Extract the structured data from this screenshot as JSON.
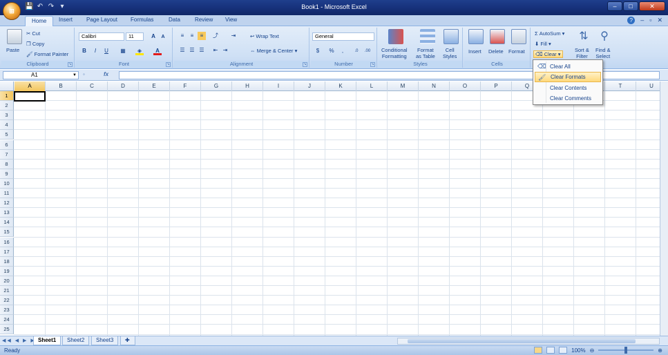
{
  "window": {
    "title": "Book1 - Microsoft Excel",
    "office_button_label": "⊞",
    "controls": [
      "–",
      "□",
      "✕"
    ]
  },
  "quick_access": [
    "💾",
    "↶",
    "↷",
    "▾"
  ],
  "tabs": [
    {
      "label": "Home",
      "active": true
    },
    {
      "label": "Insert"
    },
    {
      "label": "Page Layout"
    },
    {
      "label": "Formulas"
    },
    {
      "label": "Data"
    },
    {
      "label": "Review"
    },
    {
      "label": "View"
    }
  ],
  "ribbon_right": {
    "help": "?",
    "minimize": "–",
    "restore": "▫",
    "close": "✕"
  },
  "groups": {
    "clipboard": {
      "label": "Clipboard",
      "paste": "Paste",
      "cut": "Cut",
      "copy": "Copy",
      "format_painter": "Format Painter"
    },
    "font": {
      "label": "Font",
      "font_name": "Calibri",
      "font_size": "11",
      "grow": "A",
      "shrink": "A",
      "bold": "B",
      "italic": "I",
      "underline": "U"
    },
    "alignment": {
      "label": "Alignment",
      "wrap_text": "Wrap Text",
      "merge_center": "Merge & Center"
    },
    "number": {
      "label": "Number",
      "format": "General",
      "currency": "$",
      "percent": "%",
      "comma": ",",
      "inc_decimal": ".0",
      "dec_decimal": ".00"
    },
    "styles": {
      "label": "Styles",
      "conditional": "Conditional",
      "conditional2": "Formatting",
      "format_table": "Format",
      "format_table2": "as Table",
      "cell_styles": "Cell",
      "cell_styles2": "Styles"
    },
    "cells": {
      "label": "Cells",
      "insert": "Insert",
      "delete": "Delete",
      "format": "Format"
    },
    "editing": {
      "autosum": "AutoSum",
      "fill": "Fill",
      "clear": "Clear",
      "sort_filter": "Sort &",
      "sort_filter2": "Filter",
      "find_select": "Find &",
      "find_select2": "Select"
    }
  },
  "formula_bar": {
    "name_box": "A1",
    "fx": "fx",
    "formula": ""
  },
  "columns": [
    "A",
    "B",
    "C",
    "D",
    "E",
    "F",
    "G",
    "H",
    "I",
    "J",
    "K",
    "L",
    "M",
    "N",
    "O",
    "P",
    "Q",
    "R",
    "S",
    "T",
    "U"
  ],
  "rows": [
    "1",
    "2",
    "3",
    "4",
    "5",
    "6",
    "7",
    "8",
    "9",
    "10",
    "11",
    "12",
    "13",
    "14",
    "15",
    "16",
    "17",
    "18",
    "19",
    "20",
    "21",
    "22",
    "23",
    "24",
    "25"
  ],
  "selected_cell": "A1",
  "sheet_tabs": [
    {
      "label": "Sheet1",
      "active": true
    },
    {
      "label": "Sheet2"
    },
    {
      "label": "Sheet3"
    }
  ],
  "status": {
    "text": "Ready",
    "zoom": "100%"
  },
  "clear_menu": {
    "items": [
      {
        "label": "Clear All",
        "icon": "eraser-icon"
      },
      {
        "label": "Clear Formats",
        "icon": "clear-formats-icon",
        "highlighted": true
      },
      {
        "label": "Clear Contents"
      },
      {
        "label": "Clear Comments"
      }
    ]
  }
}
